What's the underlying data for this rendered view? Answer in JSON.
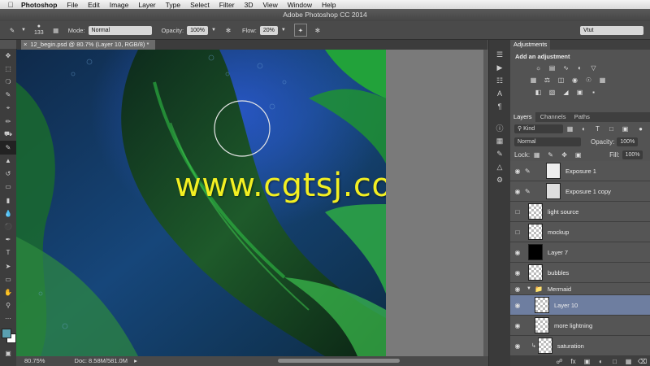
{
  "menubar": {
    "app": "Photoshop",
    "items": [
      "File",
      "Edit",
      "Image",
      "Layer",
      "Type",
      "Select",
      "Filter",
      "3D",
      "View",
      "Window",
      "Help"
    ]
  },
  "titlebar": {
    "title": "Adobe Photoshop CC 2014"
  },
  "options": {
    "brush_size": "133",
    "mode_label": "Mode:",
    "mode_value": "Normal",
    "opacity_label": "Opacity:",
    "opacity_value": "100%",
    "flow_label": "Flow:",
    "flow_value": "20%",
    "workspace": "Vtut"
  },
  "document": {
    "tab_label": "12_begin.psd @ 80.7% (Layer 10, RGB/8) *",
    "zoom": "80.75%",
    "doc_info": "Doc: 8.58M/581.0M"
  },
  "watermark": "www.cgtsj.com",
  "adjustments": {
    "tab": "Adjustments",
    "heading": "Add an adjustment"
  },
  "layers_panel": {
    "tabs": [
      "Layers",
      "Channels",
      "Paths"
    ],
    "filter_kind": "Kind",
    "blend_mode": "Normal",
    "opacity_label": "Opacity:",
    "opacity_value": "100%",
    "lock_label": "Lock:",
    "fill_label": "Fill:",
    "fill_value": "100%",
    "layers": [
      {
        "name": "Exposure 1"
      },
      {
        "name": "Exposure 1 copy"
      },
      {
        "name": "light source"
      },
      {
        "name": "mockup"
      },
      {
        "name": "Layer 7"
      },
      {
        "name": "bubbles"
      },
      {
        "name": "Mermaid"
      },
      {
        "name": "Layer 10"
      },
      {
        "name": "more lightning"
      },
      {
        "name": "saturation"
      }
    ]
  },
  "colors": {
    "foreground": "#5a9fb0",
    "background": "#ffffff",
    "selected_layer": "#6e7ea0"
  }
}
